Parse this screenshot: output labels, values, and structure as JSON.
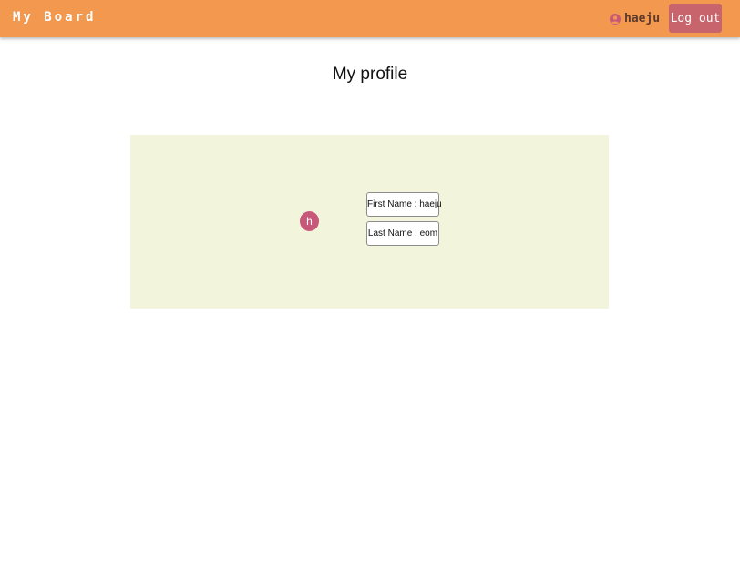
{
  "header": {
    "brand": "My Board",
    "user_name": "haeju",
    "logout_label": "Log out",
    "user_icon": "user-circle-icon"
  },
  "main": {
    "title": "My profile"
  },
  "profile": {
    "avatar_letter": "h",
    "first_name_field": "First Name : haeju",
    "last_name_field": "Last Name : eom"
  },
  "colors": {
    "header_bg": "#f2994f",
    "logout_bg": "#c8646b",
    "card_bg": "#f3f4dc",
    "avatar_bg": "#c8587a",
    "user_icon": "#c8587a"
  }
}
